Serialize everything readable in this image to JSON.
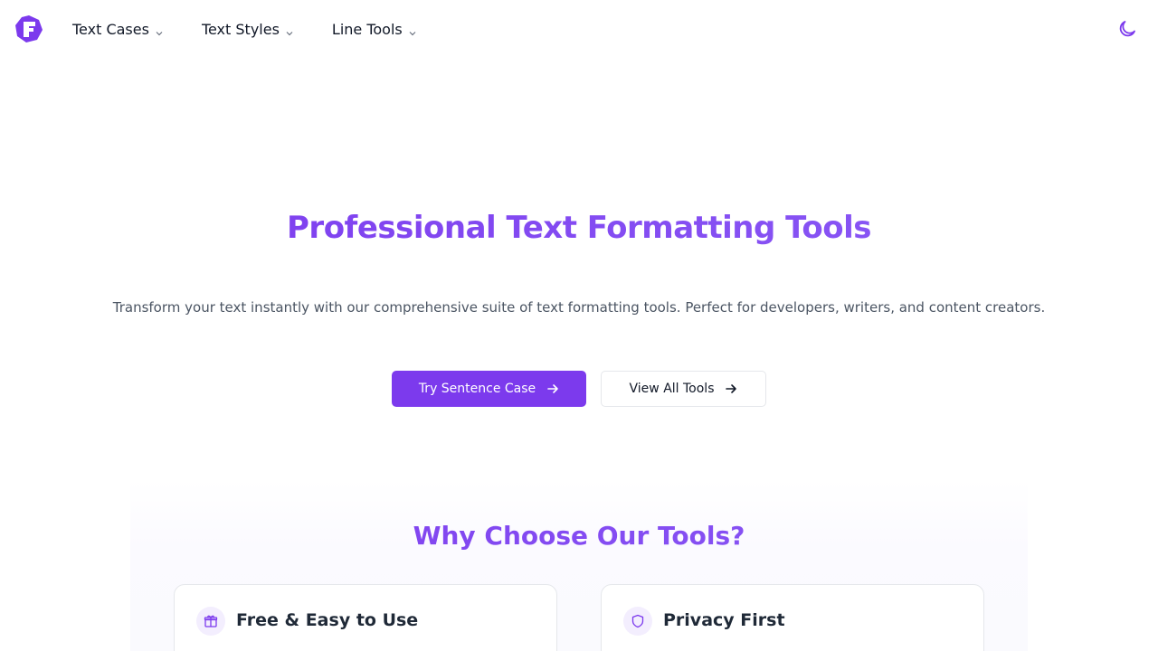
{
  "header": {
    "nav": [
      {
        "label": "Text Cases"
      },
      {
        "label": "Text Styles"
      },
      {
        "label": "Line Tools"
      }
    ]
  },
  "hero": {
    "title": "Professional Text Formatting Tools",
    "subtitle": "Transform your text instantly with our comprehensive suite of text formatting tools. Perfect for developers, writers, and content creators.",
    "primary_button": "Try Sentence Case",
    "secondary_button": "View All Tools"
  },
  "features": {
    "title": "Why Choose Our Tools?",
    "cards": [
      {
        "title": "Free & Easy to Use",
        "icon": "gift-icon"
      },
      {
        "title": "Privacy First",
        "icon": "shield-icon"
      }
    ]
  },
  "colors": {
    "accent": "#7c3aed",
    "accent_light": "#8b5cf6",
    "icon_bg": "#f3eefe"
  },
  "icons": {
    "logo": "logo-icon",
    "theme": "moon-icon",
    "arrow": "arrow-right-icon",
    "chevron": "chevron-down-icon"
  }
}
